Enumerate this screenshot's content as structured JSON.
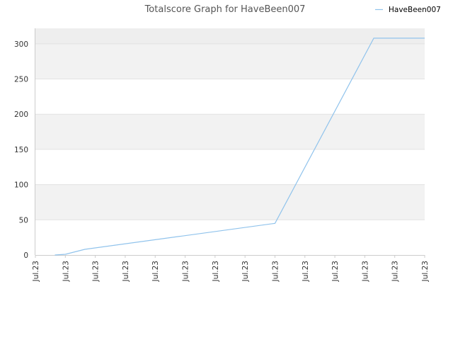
{
  "chart_data": {
    "type": "line",
    "title": "Totalscore Graph for HaveBeen007",
    "xlabel": "",
    "ylabel": "",
    "ylim": [
      0,
      322
    ],
    "yticks": [
      0,
      50,
      100,
      150,
      200,
      250,
      300
    ],
    "x_tick_labels": [
      "Jul.23",
      "Jul.23",
      "Jul.23",
      "Jul.23",
      "Jul.23",
      "Jul.23",
      "Jul.23",
      "Jul.23",
      "Jul.23",
      "Jul.23",
      "Jul.23",
      "Jul.23",
      "Jul.23",
      "Jul.23"
    ],
    "grid": true,
    "legend": "top-right",
    "series": [
      {
        "name": "HaveBeen007",
        "color": "#90c3ec",
        "x": [
          0.65,
          1.0,
          1.65,
          8.0,
          11.3,
          13.0
        ],
        "y": [
          0,
          1,
          8,
          45,
          308,
          308
        ]
      }
    ]
  }
}
